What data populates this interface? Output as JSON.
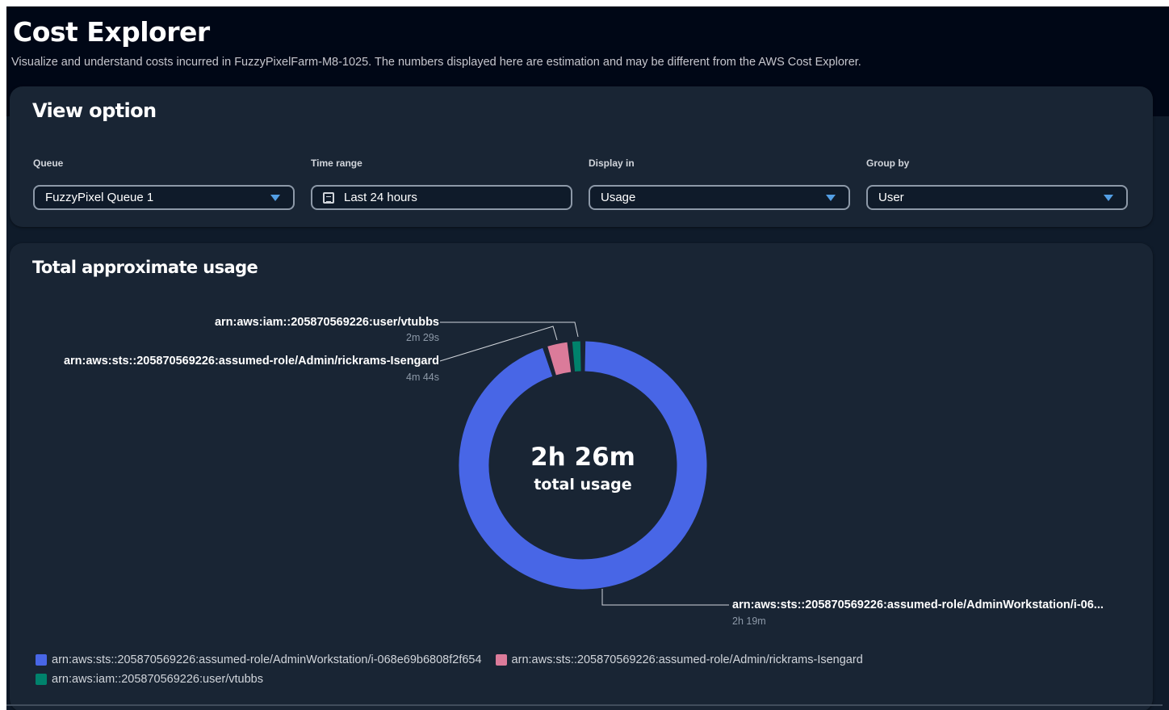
{
  "page": {
    "title": "Cost Explorer",
    "description": "Visualize and understand costs incurred in FuzzyPixelFarm-M8-1025. The numbers displayed here are estimation and may be different from the AWS Cost Explorer."
  },
  "view_option": {
    "title": "View option",
    "queue": {
      "label": "Queue",
      "value": "FuzzyPixel Queue 1"
    },
    "time_range": {
      "label": "Time range",
      "value": "Last 24 hours",
      "icon": "calendar-icon"
    },
    "display_in": {
      "label": "Display in",
      "value": "Usage"
    },
    "group_by": {
      "label": "Group by",
      "value": "User"
    }
  },
  "usage": {
    "title": "Total approximate usage",
    "total_value": "2h 26m",
    "total_caption": "total usage",
    "annotations": {
      "vtubbs": {
        "label": "arn:aws:iam::205870569226:user/vtubbs",
        "value": "2m 29s"
      },
      "rickrams": {
        "label": "arn:aws:sts::205870569226:assumed-role/Admin/rickrams-Isengard",
        "value": "4m 44s"
      },
      "workstation": {
        "label": "arn:aws:sts::205870569226:assumed-role/AdminWorkstation/i-06...",
        "value": "2h 19m"
      }
    },
    "legend": [
      {
        "label": "arn:aws:sts::205870569226:assumed-role/AdminWorkstation/i-068e69b6808f2f654",
        "color": "#4866e6"
      },
      {
        "label": "arn:aws:sts::205870569226:assumed-role/Admin/rickrams-Isengard",
        "color": "#db7b9a"
      },
      {
        "label": "arn:aws:iam::205870569226:user/vtubbs",
        "color": "#00826c"
      }
    ]
  },
  "chart_data": {
    "type": "pie",
    "title": "Total approximate usage",
    "center_label": "2h 26m total usage",
    "slices": [
      {
        "name": "arn:aws:sts::205870569226:assumed-role/AdminWorkstation/i-068e69b6808f2f654",
        "value_minutes": 139,
        "display": "2h 19m",
        "color": "#4866e6"
      },
      {
        "name": "arn:aws:sts::205870569226:assumed-role/Admin/rickrams-Isengard",
        "value_minutes": 4.73,
        "display": "4m 44s",
        "color": "#db7b9a"
      },
      {
        "name": "arn:aws:iam::205870569226:user/vtubbs",
        "value_minutes": 2.48,
        "display": "2m 29s",
        "color": "#00826c"
      }
    ],
    "legend_position": "bottom-left"
  }
}
